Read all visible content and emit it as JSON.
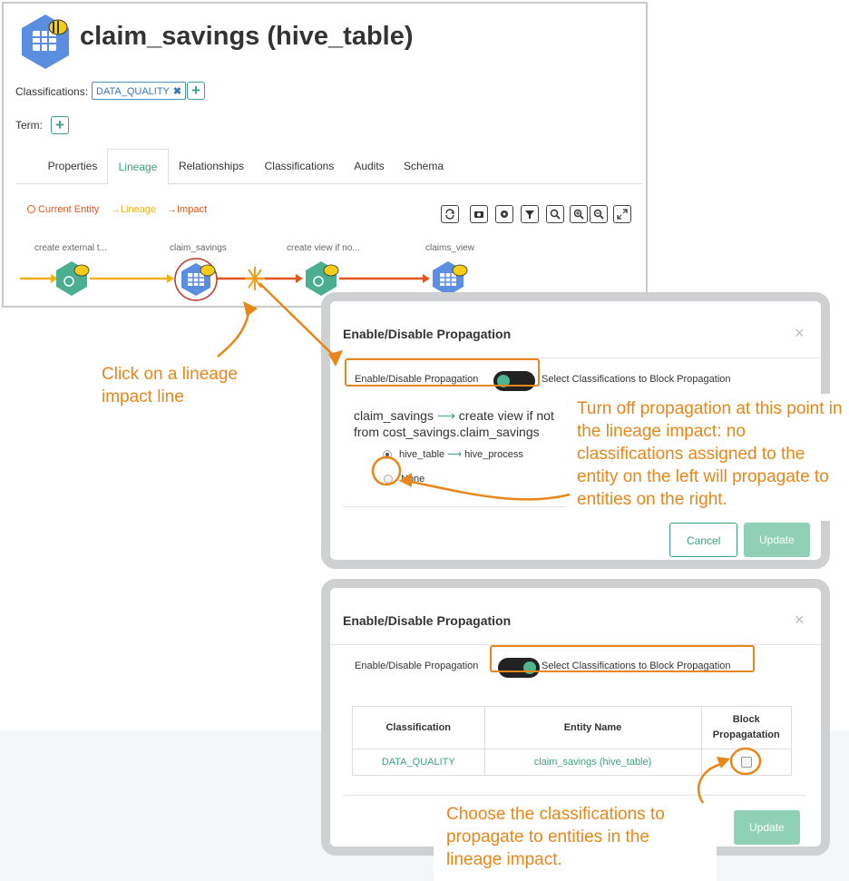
{
  "entity": {
    "title": "claim_savings (hive_table)",
    "classifications_label": "Classifications:",
    "classification_tag": "DATA_QUALITY",
    "classification_remove": "✖",
    "term_label": "Term:",
    "add_symbol": "+"
  },
  "tabs": [
    {
      "label": "Properties"
    },
    {
      "label": "Lineage",
      "active": true
    },
    {
      "label": "Relationships"
    },
    {
      "label": "Classifications"
    },
    {
      "label": "Audits"
    },
    {
      "label": "Schema"
    }
  ],
  "legend": {
    "current": "Current Entity",
    "lineage": "Lineage",
    "impact": "Impact"
  },
  "toolbar_icons": [
    "refresh-icon",
    "camera-icon",
    "gear-icon",
    "filter-icon",
    "search-icon",
    "zoom-in-icon",
    "zoom-out-icon",
    "fullscreen-icon"
  ],
  "lineage_nodes": [
    {
      "label": "create external t..."
    },
    {
      "label": "claim_savings"
    },
    {
      "label": "create view if no..."
    },
    {
      "label": "claims_view"
    }
  ],
  "dialog1": {
    "title": "Enable/Disable Propagation",
    "close": "×",
    "toggle_label": "Enable/Disable Propagation",
    "block_label": "Select Classifications to Block Propagation",
    "edge_left": "claim_savings",
    "edge_right": "create view if not",
    "edge_line2": "from cost_savings.claim_savings",
    "option1_left": "hive_table",
    "option1_right": "hive_process",
    "option2": "None",
    "cancel": "Cancel",
    "update": "Update"
  },
  "dialog2": {
    "title": "Enable/Disable Propagation",
    "close": "×",
    "toggle_label": "Enable/Disable Propagation",
    "block_label": "Select Classifications to Block Propagation",
    "table_headers": [
      "Classification",
      "Entity Name",
      "Block Propagatation"
    ],
    "table_rows": [
      {
        "classification": "DATA_QUALITY",
        "entity_name": "claim_savings (hive_table)"
      }
    ],
    "update": "Update"
  },
  "callouts": {
    "lineage_click": "Click on a lineage impact line",
    "turn_off": "Turn off propagation at this point in the lineage impact: no classifications assigned to the entity on the left will propagate to entities on the right.",
    "choose": "Choose the classifications to propagate to entities in the lineage impact."
  },
  "colors": {
    "accent_green": "#3aa37c",
    "callout_orange": "#e8861a",
    "lineage_yellow": "#f0b11b",
    "impact_red": "#e3561f",
    "node_blue": "#5b8de0",
    "node_teal": "#4cae90"
  }
}
